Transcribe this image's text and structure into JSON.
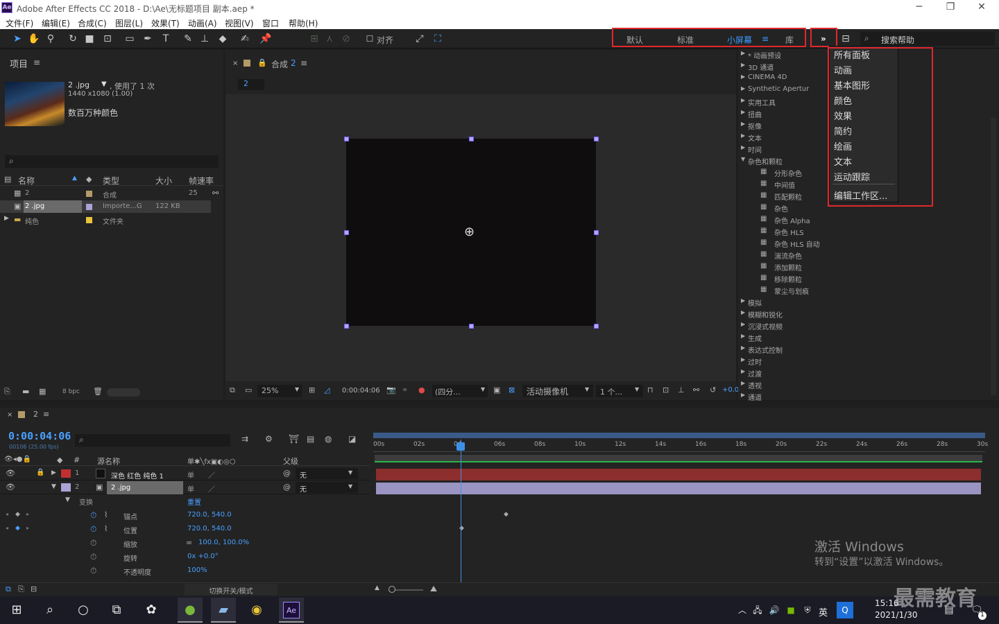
{
  "window": {
    "title": "Adobe After Effects CC 2018 - D:\\Ae\\无标题项目 副本.aep *",
    "app_icon": "Ae",
    "minimize": "─",
    "restore": "❐",
    "close": "✕"
  },
  "menu": [
    "文件(F)",
    "编辑(E)",
    "合成(C)",
    "图层(L)",
    "效果(T)",
    "动画(A)",
    "视图(V)",
    "窗口",
    "帮助(H)"
  ],
  "toolbar": {
    "snap_label": "对齐",
    "workspaces": [
      "默认",
      "标准",
      "小屏幕",
      "库"
    ],
    "active_workspace": "小屏幕",
    "more": "»",
    "search_placeholder": "搜索帮助"
  },
  "workspace_menu": [
    "所有面板",
    "动画",
    "基本图形",
    "颜色",
    "效果",
    "简约",
    "绘画",
    "文本",
    "运动跟踪",
    "编辑工作区..."
  ],
  "project": {
    "title": "项目",
    "file_name": "2 .jpg",
    "file_usage": ", 使用了 1 次",
    "file_dims": "1440 x1080 (1.00)",
    "file_color": "数百万种颜色",
    "search_placeholder": "",
    "columns": [
      "名称",
      "类型",
      "大小",
      "帧速率"
    ],
    "rows": [
      {
        "name": "2",
        "type": "合成",
        "size": "",
        "fps": "25"
      },
      {
        "name": "2 .jpg",
        "type": "Importe...G",
        "size": "122 KB",
        "fps": ""
      },
      {
        "name": "纯色",
        "type": "文件夹",
        "size": "",
        "fps": ""
      }
    ],
    "bpc": "8 bpc"
  },
  "comp": {
    "tab": "合成",
    "tab_num": "2",
    "breadcrumb": "2",
    "zoom": "25%",
    "timecode": "0:00:04:06",
    "view": "(四分...",
    "camera": "活动摄像机",
    "views": "1 个...",
    "exposure": "+0.0"
  },
  "effects": {
    "categories_top": [
      "* 动画预设",
      "3D 通道",
      "CINEMA 4D",
      "Synthetic Apertur",
      "实用工具",
      "扭曲",
      "抠像",
      "文本",
      "时间",
      "杂色和颗粒"
    ],
    "noise_items": [
      "分形杂色",
      "中间值",
      "匹配颗粒",
      "杂色",
      "杂色 Alpha",
      "杂色 HLS",
      "杂色 HLS 自动",
      "湍流杂色",
      "添加颗粒",
      "移除颗粒",
      "蒙尘与划痕"
    ],
    "categories_bottom": [
      "模拟",
      "模糊和锐化",
      "沉浸式视频",
      "生成",
      "表达式控制",
      "过时",
      "过渡",
      "透视",
      "通道"
    ]
  },
  "timeline": {
    "tab": "2",
    "timecode": "0:00:04:06",
    "frames": "00106 (25.00 fps)",
    "ruler": [
      "00s",
      "02s",
      "04s",
      "06s",
      "08s",
      "10s",
      "12s",
      "14s",
      "16s",
      "18s",
      "20s",
      "22s",
      "24s",
      "26s",
      "28s",
      "30s"
    ],
    "col_source": "源名称",
    "col_parent": "父级",
    "layers": [
      {
        "num": "1",
        "name": "深色 红色 纯色 1",
        "parent": "无"
      },
      {
        "num": "2",
        "name": "2 .jpg",
        "parent": "无"
      }
    ],
    "transform": "变换",
    "reset": "重置",
    "props": [
      {
        "name": "锚点",
        "value": "720.0, 540.0"
      },
      {
        "name": "位置",
        "value": "720.0, 540.0"
      },
      {
        "name": "缩放",
        "value": "100.0, 100.0%"
      },
      {
        "name": "旋转",
        "value": "0x +0.0°"
      },
      {
        "name": "不透明度",
        "value": "100%"
      }
    ],
    "toggle": "切换开关/模式"
  },
  "watermark": {
    "line1": "激活 Windows",
    "line2": "转到“设置”以激活 Windows。",
    "brand": "最需教育"
  },
  "taskbar": {
    "time": "15:16",
    "date": "2021/1/30",
    "lang": "英",
    "notif": "1"
  },
  "colors": {
    "accent": "#2d8ceb",
    "redbox": "#e0282c",
    "layer_red": "#8c2e2e",
    "layer_lav": "#9a94c2"
  }
}
